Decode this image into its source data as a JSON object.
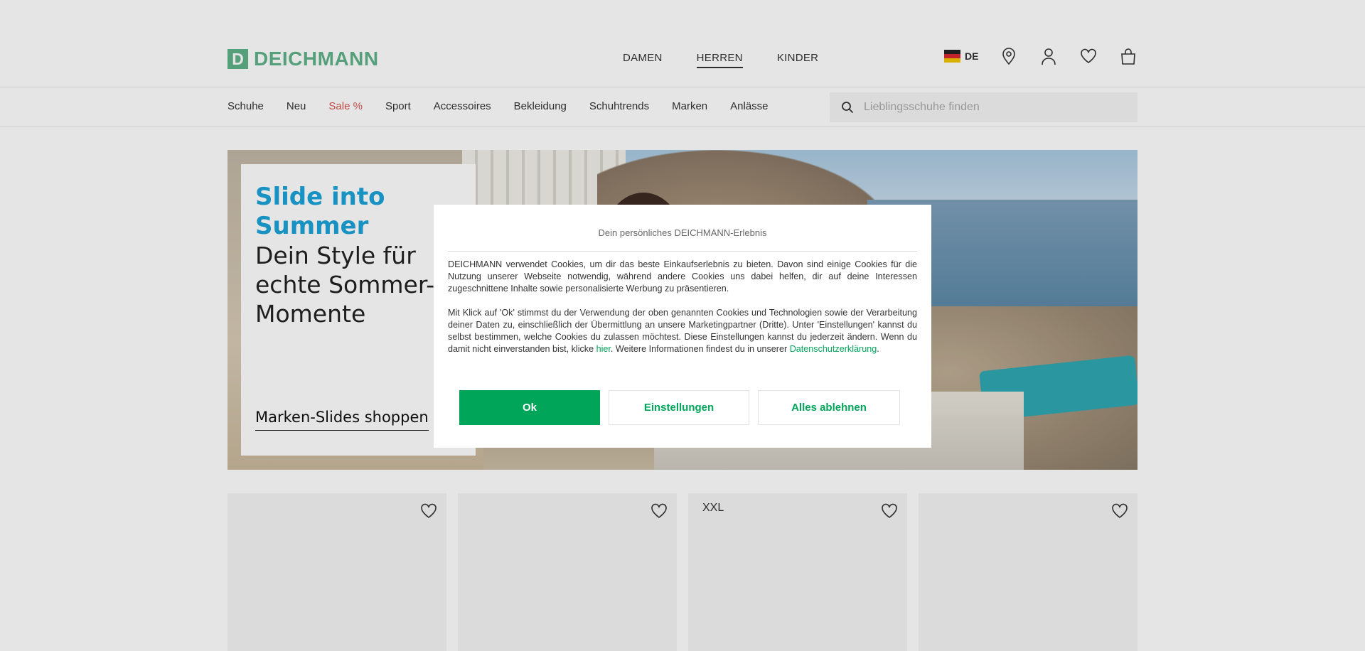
{
  "header": {
    "logo_letter": "D",
    "logo_text": "DEICHMANN",
    "gender_nav": [
      {
        "label": "DAMEN",
        "active": false
      },
      {
        "label": "HERREN",
        "active": true
      },
      {
        "label": "KINDER",
        "active": false
      }
    ],
    "language": "DE",
    "icons": [
      "location-pin-icon",
      "user-icon",
      "heart-icon",
      "shopping-bag-icon"
    ]
  },
  "categories": [
    {
      "label": "Schuhe"
    },
    {
      "label": "Neu"
    },
    {
      "label": "Sale %",
      "highlight": "#d9534f"
    },
    {
      "label": "Sport"
    },
    {
      "label": "Accessoires"
    },
    {
      "label": "Bekleidung"
    },
    {
      "label": "Schuhtrends"
    },
    {
      "label": "Marken"
    },
    {
      "label": "Anlässe"
    }
  ],
  "search": {
    "placeholder": "Lieblingsschuhe finden"
  },
  "hero": {
    "title": "Slide into Summer",
    "subtitle": "Dein Style für echte Sommer-Momente",
    "cta": "Marken-Slides shoppen"
  },
  "tiles": [
    {
      "badge": ""
    },
    {
      "badge": ""
    },
    {
      "badge": "XXL"
    },
    {
      "badge": ""
    }
  ],
  "cookie_dialog": {
    "title": "Dein persönliches DEICHMANN-Erlebnis",
    "paragraph1": "DEICHMANN verwendet Cookies, um dir das beste Einkaufserlebnis zu bieten. Davon sind einige Cookies für die Nutzung unserer Webseite notwendig, während andere Cookies uns dabei helfen, dir auf deine Interessen zugeschnittene Inhalte sowie personalisierte Werbung zu präsentieren.",
    "paragraph2_before": "Mit Klick auf 'Ok' stimmst du der Verwendung der oben genannten Cookies und Technologien sowie der Verarbeitung deiner Daten zu, einschließlich der Übermittlung an unsere Marketingpartner (Dritte). Unter 'Einstellungen' kannst du selbst bestimmen, welche Cookies du zulassen möchtest. Diese Einstellungen kannst du jederzeit ändern. Wenn du damit nicht einverstanden bist, klicke ",
    "link_here": "hier",
    "paragraph2_middle": ". Weitere Informationen findest du in unserer ",
    "link_privacy": "Datenschutzerklärung",
    "paragraph2_end": ".",
    "btn_ok": "Ok",
    "btn_settings": "Einstellungen",
    "btn_reject": "Alles ablehnen"
  },
  "colors": {
    "brand_green": "#5fb38a",
    "accent_green": "#00a55a",
    "hero_title": "#1aa3d9",
    "sale_red": "#d9534f"
  }
}
